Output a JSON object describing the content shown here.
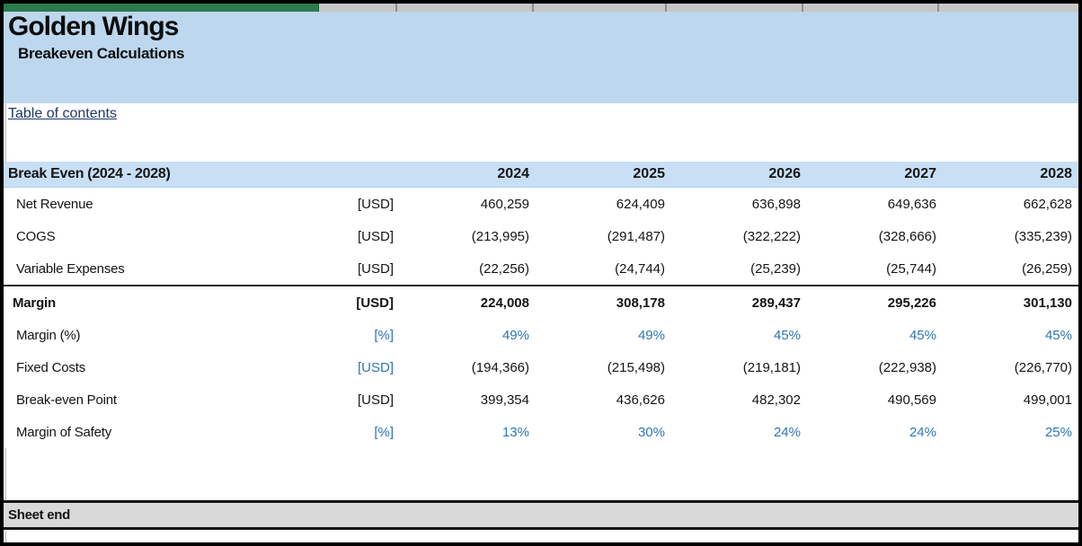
{
  "header": {
    "title": "Golden Wings",
    "subtitle": "Breakeven Calculations"
  },
  "toc_link": "Table of contents",
  "table": {
    "title": "Break Even (2024 - 2028)",
    "years": [
      "2024",
      "2025",
      "2026",
      "2027",
      "2028"
    ],
    "rows": [
      {
        "label": "Net Revenue",
        "unit": "[USD]",
        "values": [
          "460,259",
          "624,409",
          "636,898",
          "649,636",
          "662,628"
        ],
        "bold": false,
        "topline": false,
        "unit_blue": false,
        "values_blue": false
      },
      {
        "label": "COGS",
        "unit": "[USD]",
        "values": [
          "(213,995)",
          "(291,487)",
          "(322,222)",
          "(328,666)",
          "(335,239)"
        ],
        "bold": false,
        "topline": false,
        "unit_blue": false,
        "values_blue": false
      },
      {
        "label": "Variable Expenses",
        "unit": "[USD]",
        "values": [
          "(22,256)",
          "(24,744)",
          "(25,239)",
          "(25,744)",
          "(26,259)"
        ],
        "bold": false,
        "topline": false,
        "unit_blue": false,
        "values_blue": false
      },
      {
        "label": "Margin",
        "unit": "[USD]",
        "values": [
          "224,008",
          "308,178",
          "289,437",
          "295,226",
          "301,130"
        ],
        "bold": true,
        "topline": true,
        "unit_blue": false,
        "values_blue": false
      },
      {
        "label": "Margin (%)",
        "unit": "[%]",
        "values": [
          "49%",
          "49%",
          "45%",
          "45%",
          "45%"
        ],
        "bold": false,
        "topline": false,
        "unit_blue": true,
        "values_blue": true
      },
      {
        "label": "Fixed Costs",
        "unit": "[USD]",
        "values": [
          "(194,366)",
          "(215,498)",
          "(219,181)",
          "(222,938)",
          "(226,770)"
        ],
        "bold": false,
        "topline": false,
        "unit_blue": true,
        "values_blue": false
      },
      {
        "label": "Break-even Point",
        "unit": "[USD]",
        "values": [
          "399,354",
          "436,626",
          "482,302",
          "490,569",
          "499,001"
        ],
        "bold": false,
        "topline": false,
        "unit_blue": false,
        "values_blue": false
      },
      {
        "label": "Margin of Safety",
        "unit": "[%]",
        "values": [
          "13%",
          "30%",
          "24%",
          "24%",
          "25%"
        ],
        "bold": false,
        "topline": false,
        "unit_blue": true,
        "values_blue": true
      }
    ]
  },
  "footer": {
    "sheet_end": "Sheet end"
  },
  "colors": {
    "title_band_blue": "#BDD7EE",
    "table_header_blue": "#C8DFF5",
    "accent_blue_text": "#2E75B6",
    "link_navy": "#1F3864",
    "top_green_bar": "#2B7B4C",
    "top_gray_strip": "#C7C7C7",
    "sheet_end_gray": "#D9D9D9"
  }
}
